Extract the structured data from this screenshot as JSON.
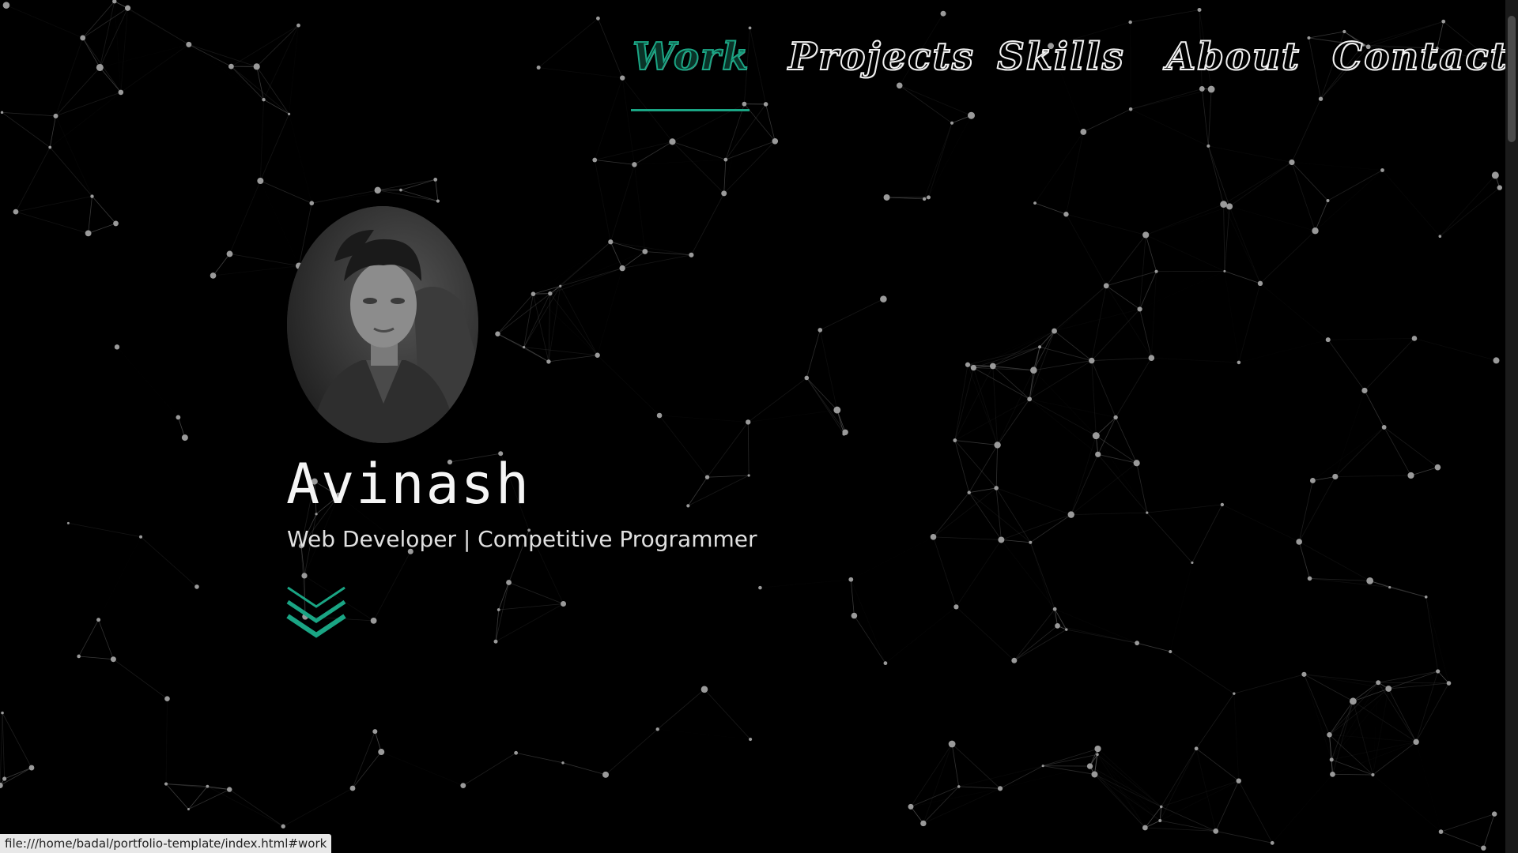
{
  "nav": {
    "items": [
      {
        "label": "Work",
        "href": "#work",
        "active": true
      },
      {
        "label": "Projects",
        "href": "#projects",
        "active": false
      },
      {
        "label": "Skills",
        "href": "#skills",
        "active": false
      },
      {
        "label": "About",
        "href": "#about",
        "active": false
      },
      {
        "label": "Contact",
        "href": "#contact",
        "active": false
      }
    ]
  },
  "hero": {
    "name": "Avinash",
    "tagline": "Web Developer | Competitive Programmer",
    "photo_alt": "profile-photo"
  },
  "status_bar": {
    "url": "file:///home/badal/portfolio-template/index.html#work"
  },
  "colors": {
    "background": "#000000",
    "accent": "#1aa584",
    "text": "#f5f5f5",
    "network_line": "#5a5a5a",
    "network_node": "#9a9a9a"
  },
  "icons": {
    "scroll_down": "double-chevron-down-icon"
  }
}
